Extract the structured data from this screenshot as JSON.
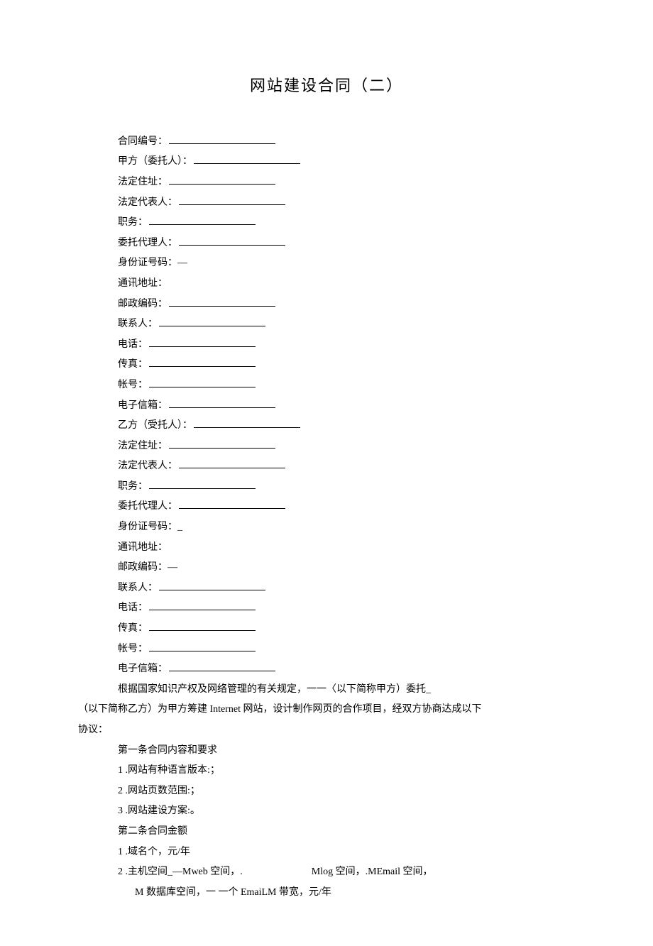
{
  "title": "网站建设合同（二）",
  "partyA": {
    "contract_no_label": "合同编号：",
    "name_label": "甲方（委托人）：",
    "address_label": "法定住址：",
    "legal_rep_label": "法定代表人：",
    "position_label": "职务：",
    "agent_label": "委托代理人：",
    "id_label": "身份证号码：—",
    "mail_addr_label": "通讯地址：",
    "postal_label": "邮政编码：",
    "contact_label": "联系人：",
    "phone_label": "电话：",
    "fax_label": "传真：",
    "account_label": "帐号：",
    "email_label": "电子信箱："
  },
  "partyB": {
    "name_label": "乙方（受托人）：",
    "address_label": "法定住址：",
    "legal_rep_label": "法定代表人：",
    "position_label": "职务：",
    "agent_label": "委托代理人：",
    "id_label": "身份证号码：_",
    "mail_addr_label": "通讯地址：",
    "postal_label": "邮政编码：—",
    "contact_label": "联系人：",
    "phone_label": "电话：",
    "fax_label": "传真：",
    "account_label": "帐号：",
    "email_label": "电子信箱："
  },
  "preamble": {
    "l1": "根据国家知识产权及网络管理的有关规定，一一〈以下简称甲方）委托_",
    "l2": "（以下简称乙方）为甲方筹建 Internet 网站，设计制作网页的合作项目，经双方协商达成以下",
    "l3": "协议："
  },
  "article1": {
    "heading": "第一条合同内容和要求",
    "i1": "1 .网站有种语言版本:；",
    "i2": "2 .网站页数范围:；",
    "i3": "3 .网站建设方案:。"
  },
  "article2": {
    "heading": "第二条合同金额",
    "i1": "1 .域名个，元/年",
    "i2a": "2 .主机空间_—Mweb 空间，.",
    "i2b": "Mlog 空间，.MEmail 空间，",
    "i3": "M 数据库空间，一    一个 EmaiLM 带宽，元/年"
  }
}
